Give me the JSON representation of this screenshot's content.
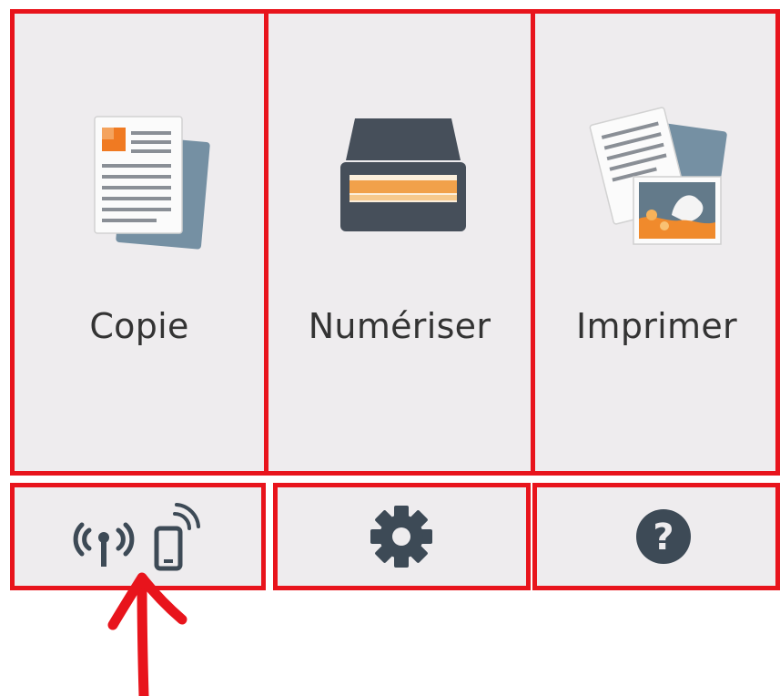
{
  "main_menu": {
    "tiles": [
      {
        "label": "Copie",
        "icon": "copy-document-icon"
      },
      {
        "label": "Numériser",
        "icon": "scanner-icon"
      },
      {
        "label": "Imprimer",
        "icon": "print-photo-icon"
      }
    ]
  },
  "bottom_bar": {
    "items": [
      {
        "icon": "wireless-direct-icon"
      },
      {
        "icon": "gear-icon"
      },
      {
        "icon": "help-icon",
        "glyph": "?"
      }
    ]
  },
  "colors": {
    "tile_background": "#eeecee",
    "annotation_red": "#e8141c",
    "icon_dark": "#3d4a56",
    "label_text": "#333333"
  }
}
